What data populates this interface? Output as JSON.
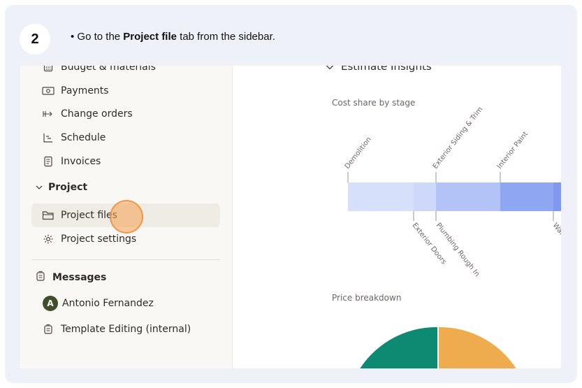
{
  "step": {
    "number": "2"
  },
  "instruction": {
    "prefix": "• Go to the ",
    "bold": "Project file",
    "suffix": " tab from the sidebar."
  },
  "sidebar": {
    "items": [
      {
        "label": "Budget & materials",
        "icon": "calculator-icon"
      },
      {
        "label": "Payments",
        "icon": "cash-icon"
      },
      {
        "label": "Change orders",
        "icon": "change-orders-icon"
      },
      {
        "label": "Schedule",
        "icon": "schedule-icon"
      },
      {
        "label": "Invoices",
        "icon": "invoice-icon"
      }
    ],
    "project_section": {
      "label": "Project",
      "icon": "chevron-down-icon"
    },
    "project_items": [
      {
        "label": "Project files",
        "icon": "folder-icon",
        "active": true
      },
      {
        "label": "Project settings",
        "icon": "gear-icon"
      }
    ],
    "messages_section": {
      "label": "Messages",
      "icon": "message-icon"
    },
    "message_items": [
      {
        "label": "Antonio Fernandez",
        "avatar_letter": "A"
      },
      {
        "label": "Template Editing (internal)",
        "icon": "message-icon"
      }
    ]
  },
  "main": {
    "insights_title": "Estimate Insights",
    "cost_share_label": "Cost share by stage",
    "price_breakdown_label": "Price breakdown",
    "stage_labels_top": [
      "Demolition",
      "Exterior Siding & Trim",
      "Interior Paint"
    ],
    "stage_labels_bottom": [
      "Exterior Doors",
      "Plumbing Rough In",
      "Wal"
    ]
  },
  "colors": {
    "bar_light": "#d7e0fb",
    "bar_mid": "#b3c3f7",
    "bar_dark": "#8fa6f2",
    "pie_green": "#0e8a72",
    "pie_orange": "#efac4f",
    "click_marker": "#f5a050"
  }
}
